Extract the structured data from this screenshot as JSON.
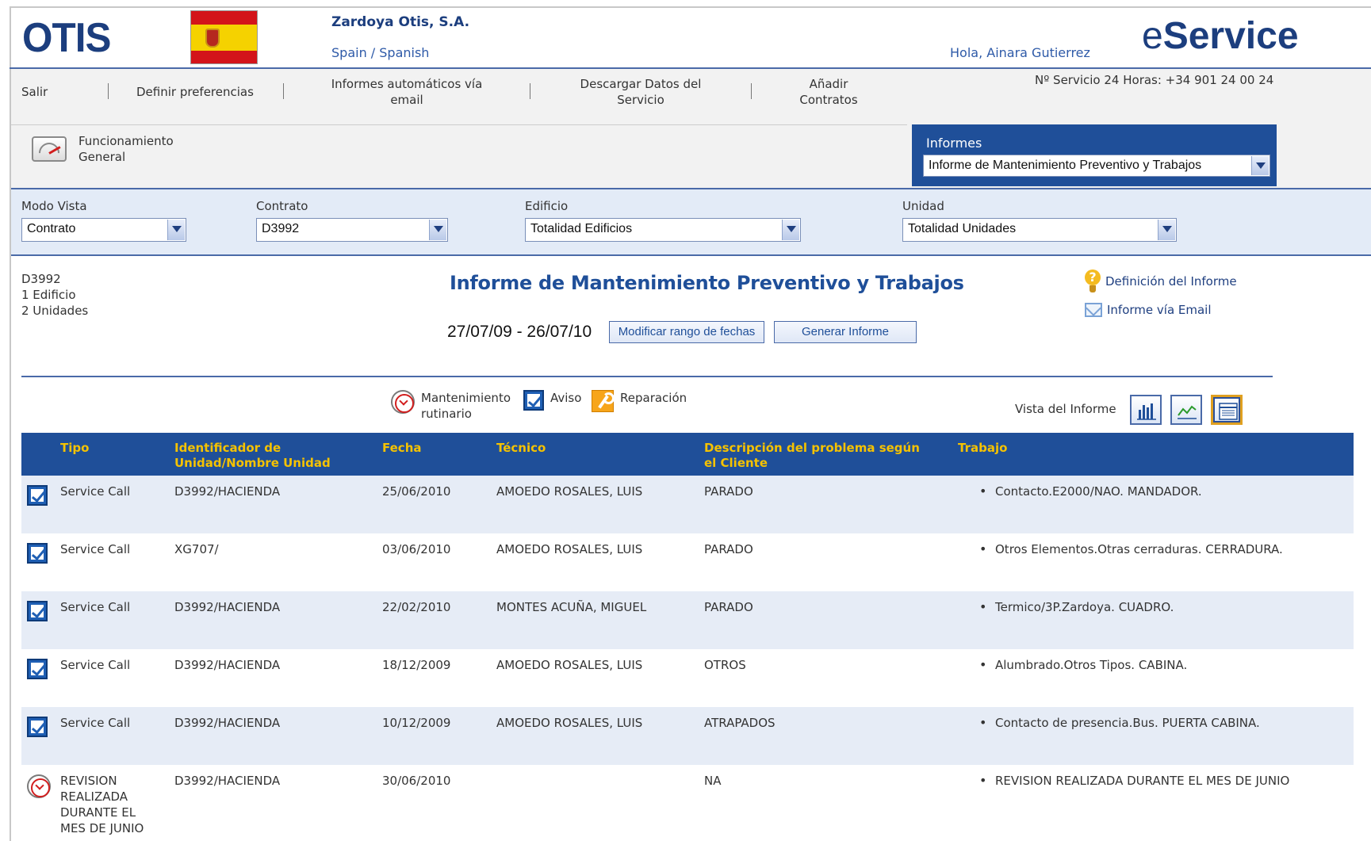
{
  "header": {
    "logo": "OTIS",
    "company": "Zardoya Otis, S.A.",
    "language": "Spain / Spanish",
    "greeting": "Hola, Ainara Gutierrez",
    "brand_prefix": "e",
    "brand_rest": "Service"
  },
  "nav": {
    "items": [
      {
        "label": "Salir"
      },
      {
        "label": "Definir preferencias"
      },
      {
        "label": "Informes automáticos vía email"
      },
      {
        "label": "Descargar Datos del Servicio"
      },
      {
        "label": "Añadir Contratos"
      }
    ],
    "phone": "Nº Servicio 24 Horas: +34 901 24 00 24",
    "general": "Funcionamiento General"
  },
  "informes": {
    "label": "Informes",
    "selected": "Informe de Mantenimiento Preventivo y Trabajos"
  },
  "filters": [
    {
      "label": "Modo Vista",
      "value": "Contrato"
    },
    {
      "label": "Contrato",
      "value": "D3992"
    },
    {
      "label": "Edificio",
      "value": "Totalidad Edificios"
    },
    {
      "label": "Unidad",
      "value": "Totalidad Unidades"
    }
  ],
  "summary": {
    "contract": "D3992",
    "buildings": "1 Edificio",
    "units": "2 Unidades"
  },
  "report": {
    "title": "Informe de Mantenimiento Preventivo y Trabajos",
    "date_range": "27/07/09 - 26/07/10",
    "modify_button": "Modificar rango de fechas",
    "generate_button": "Generar Informe",
    "definition_link": "Definición del Informe",
    "email_link": "Informe vía Email"
  },
  "legend": {
    "maintenance": "Mantenimiento rutinario",
    "aviso": "Aviso",
    "repair": "Reparación",
    "view_label": "Vista del Informe"
  },
  "table": {
    "headers": {
      "tipo": "Tipo",
      "unit": "Identificador de Unidad/Nombre Unidad",
      "fecha": "Fecha",
      "tecnico": "Técnico",
      "descripcion": "Descripción del problema según el Cliente",
      "trabajo": "Trabajo"
    },
    "rows": [
      {
        "icon": "aviso",
        "tipo": "Service Call",
        "unit": "D3992/HACIENDA",
        "fecha": "25/06/2010",
        "tecnico": "AMOEDO ROSALES, LUIS",
        "descripcion": "PARADO",
        "trabajo": "Contacto.E2000/NAO. MANDADOR."
      },
      {
        "icon": "aviso",
        "tipo": "Service Call",
        "unit": "XG707/",
        "fecha": "03/06/2010",
        "tecnico": "AMOEDO ROSALES, LUIS",
        "descripcion": "PARADO",
        "trabajo": "Otros Elementos.Otras cerraduras. CERRADURA."
      },
      {
        "icon": "aviso",
        "tipo": "Service Call",
        "unit": "D3992/HACIENDA",
        "fecha": "22/02/2010",
        "tecnico": "MONTES ACUÑA, MIGUEL",
        "descripcion": "PARADO",
        "trabajo": "Termico/3P.Zardoya. CUADRO."
      },
      {
        "icon": "aviso",
        "tipo": "Service Call",
        "unit": "D3992/HACIENDA",
        "fecha": "18/12/2009",
        "tecnico": "AMOEDO ROSALES, LUIS",
        "descripcion": "OTROS",
        "trabajo": "Alumbrado.Otros Tipos. CABINA."
      },
      {
        "icon": "aviso",
        "tipo": "Service Call",
        "unit": "D3992/HACIENDA",
        "fecha": "10/12/2009",
        "tecnico": "AMOEDO ROSALES, LUIS",
        "descripcion": "ATRAPADOS",
        "trabajo": "Contacto de presencia.Bus. PUERTA CABINA."
      },
      {
        "icon": "maintenance",
        "tipo": "REVISION REALIZADA DURANTE EL MES DE JUNIO",
        "unit": "D3992/HACIENDA",
        "fecha": "30/06/2010",
        "tecnico": "",
        "descripcion": "NA",
        "trabajo": "REVISION REALIZADA DURANTE EL MES DE JUNIO"
      }
    ]
  },
  "colors": {
    "brand_blue": "#1f4f99",
    "header_text": "#f5c200",
    "row_alt": "#e6ecf6"
  }
}
